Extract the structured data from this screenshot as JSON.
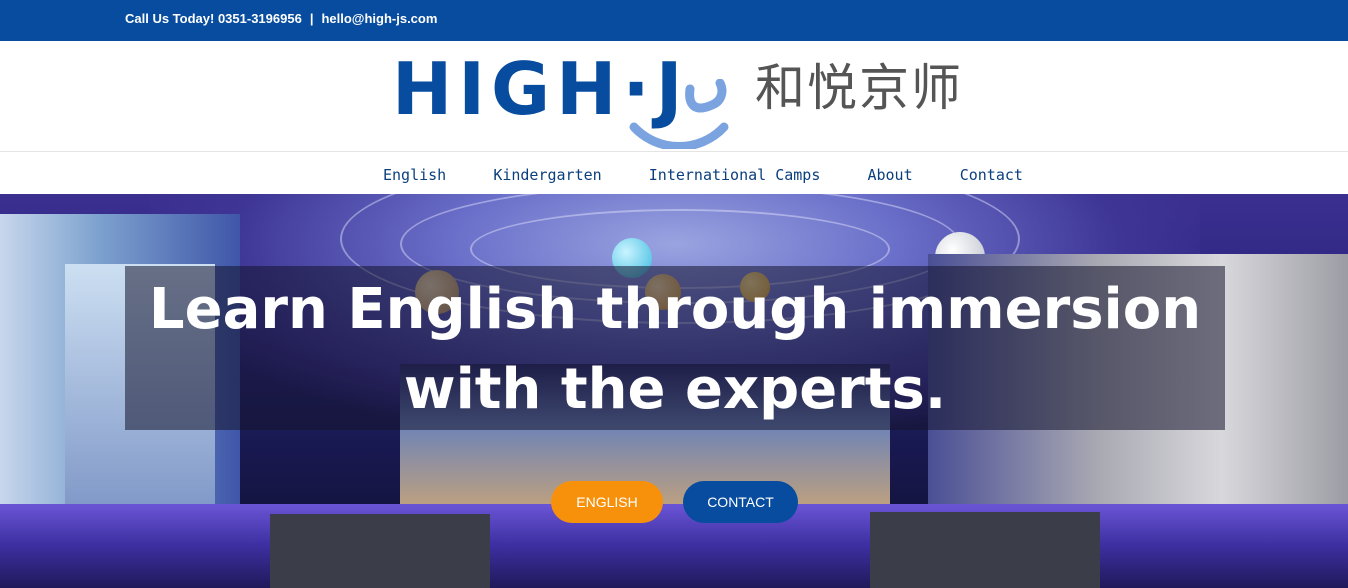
{
  "topbar": {
    "call_text": "Call Us Today! 0351-3196956",
    "separator": "|",
    "email": "hello@high-js.com",
    "background": "#074c9e"
  },
  "logo": {
    "latin": "HIGH·J",
    "chinese": "和悦京师",
    "primary_color": "#074c9e",
    "accent_color": "#7aa3e0"
  },
  "nav": {
    "items": [
      {
        "label": "English"
      },
      {
        "label": "Kindergarten"
      },
      {
        "label": "International Camps"
      },
      {
        "label": "About"
      },
      {
        "label": "Contact"
      }
    ]
  },
  "hero": {
    "headline": "Learn English through immersion with the experts.",
    "buttons": {
      "english_label": "ENGLISH",
      "contact_label": "CONTACT",
      "english_color": "#f7910b",
      "contact_color": "#074c9e"
    }
  }
}
